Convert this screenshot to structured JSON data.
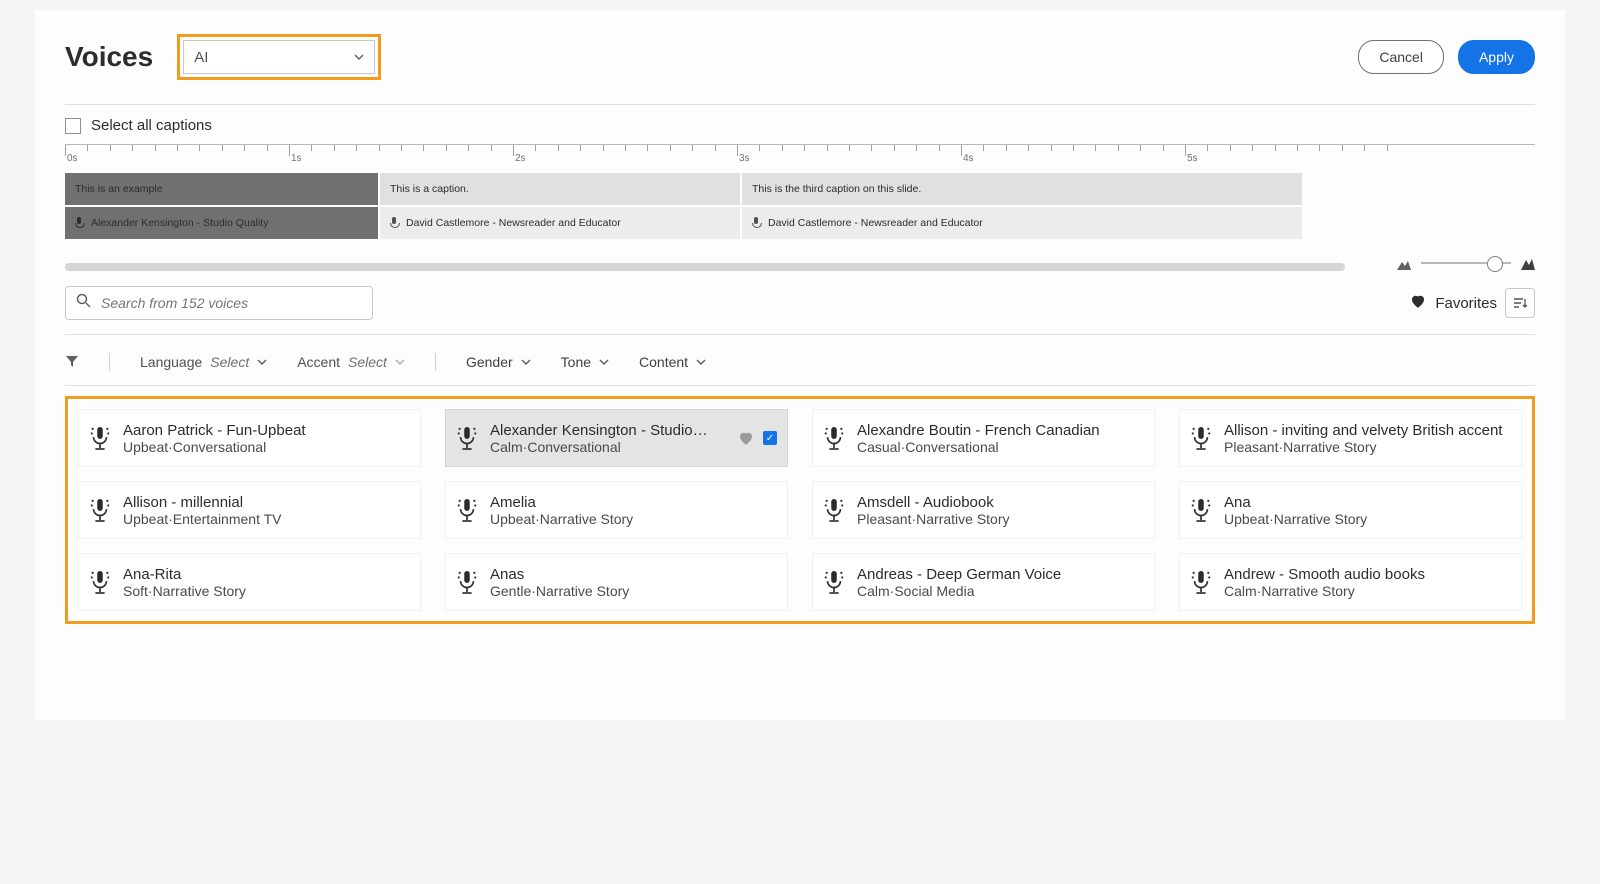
{
  "header": {
    "title": "Voices",
    "dropdown_value": "AI",
    "cancel": "Cancel",
    "apply": "Apply"
  },
  "selectAll": "Select all captions",
  "timeline": {
    "marks": [
      "0s",
      "1s",
      "2s",
      "3s",
      "4s",
      "5s"
    ],
    "captions": [
      "This is an example",
      "This is a caption.",
      "This is the third caption on this slide."
    ],
    "assigned": [
      "Alexander Kensington - Studio Quality",
      "David Castlemore - Newsreader and Educator",
      "David Castlemore - Newsreader and Educator"
    ]
  },
  "search": {
    "placeholder": "Search from 152 voices"
  },
  "favorites": "Favorites",
  "filters": {
    "language_lbl": "Language",
    "language_sel": "Select",
    "accent_lbl": "Accent",
    "accent_sel": "Select",
    "gender": "Gender",
    "tone": "Tone",
    "content": "Content"
  },
  "voices": [
    {
      "name": "Aaron Patrick - Fun-Upbeat",
      "tags": "Upbeat·Conversational"
    },
    {
      "name": "Alexander Kensington - Studio…",
      "tags": "Calm·Conversational",
      "selected": true
    },
    {
      "name": "Alexandre Boutin - French Canadian",
      "tags": "Casual·Conversational"
    },
    {
      "name": "Allison - inviting and velvety British accent",
      "tags": "Pleasant·Narrative Story"
    },
    {
      "name": "Allison - millennial",
      "tags": "Upbeat·Entertainment TV"
    },
    {
      "name": "Amelia",
      "tags": "Upbeat·Narrative Story"
    },
    {
      "name": "Amsdell - Audiobook",
      "tags": "Pleasant·Narrative Story"
    },
    {
      "name": "Ana",
      "tags": "Upbeat·Narrative Story"
    },
    {
      "name": "Ana-Rita",
      "tags": "Soft·Narrative Story"
    },
    {
      "name": "Anas",
      "tags": "Gentle·Narrative Story"
    },
    {
      "name": "Andreas - Deep German Voice",
      "tags": "Calm·Social Media"
    },
    {
      "name": "Andrew - Smooth audio books",
      "tags": "Calm·Narrative Story"
    }
  ]
}
